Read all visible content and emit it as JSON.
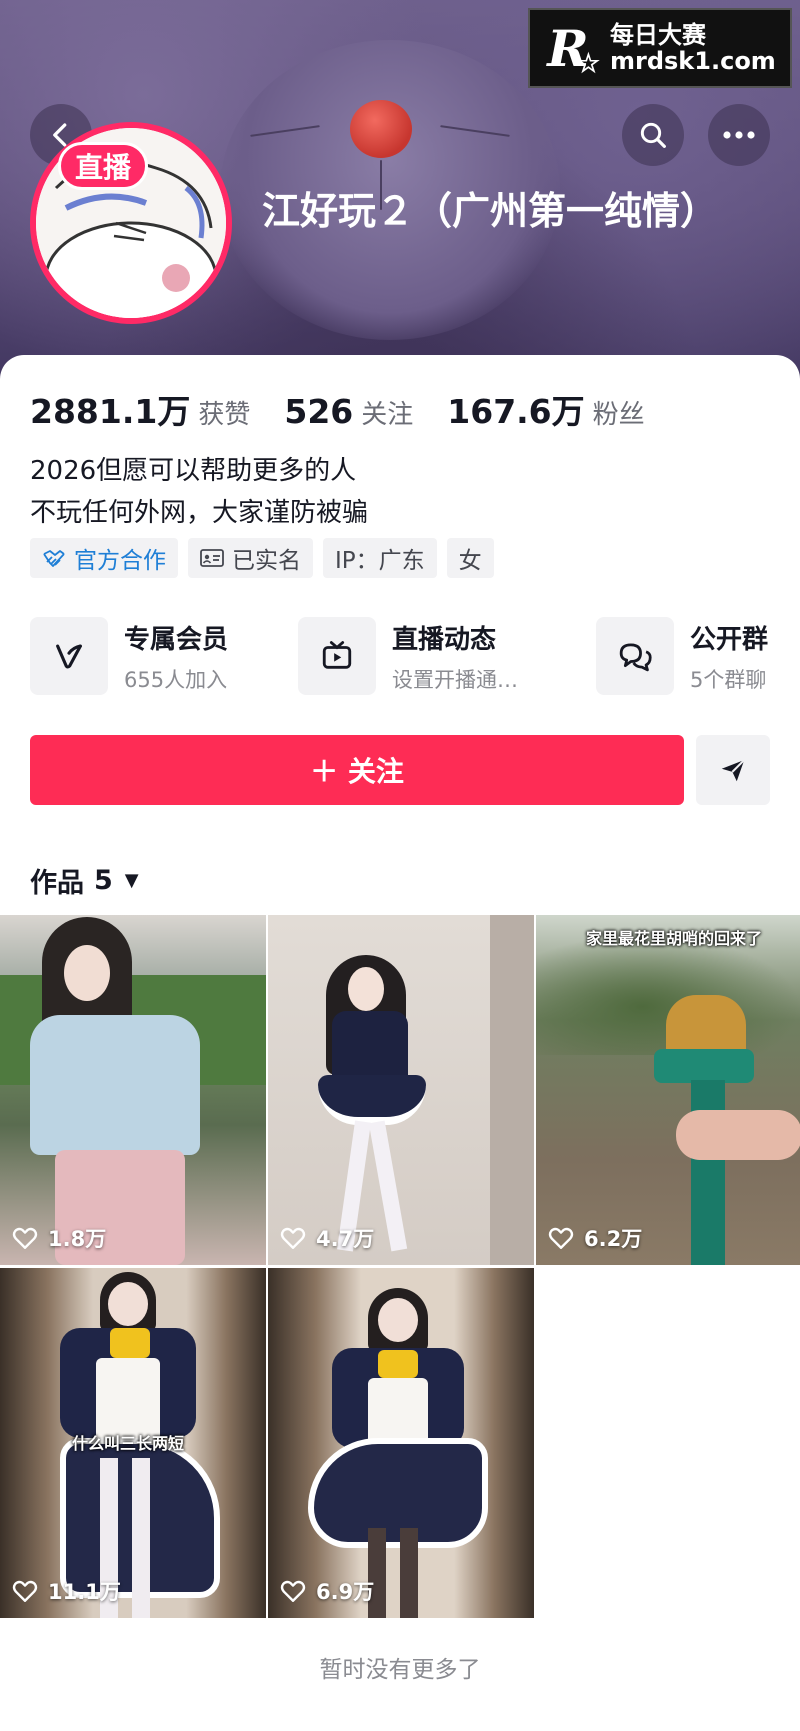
{
  "watermark": {
    "logo": "R",
    "cn": "每日大赛",
    "url": "mrdsk1.com"
  },
  "header": {
    "live_badge": "直播",
    "nickname": "江好玩２（广州第一纯情）"
  },
  "stats": [
    {
      "value": "2881.1万",
      "label": "获赞"
    },
    {
      "value": "526",
      "label": "关注"
    },
    {
      "value": "167.6万",
      "label": "粉丝"
    }
  ],
  "bio": [
    "2026但愿可以帮助更多的人",
    "不玩任何外网，大家谨防被骗"
  ],
  "tags": [
    {
      "label": "官方合作",
      "icon": "handshake-icon"
    },
    {
      "label": "已实名",
      "icon": "id-card-icon"
    },
    {
      "label": "IP：广东",
      "icon": ""
    },
    {
      "label": "女",
      "icon": ""
    }
  ],
  "features": [
    {
      "title": "专属会员",
      "sub": "655人加入",
      "icon": "v-icon"
    },
    {
      "title": "直播动态",
      "sub": "设置开播通…",
      "icon": "tv-icon"
    },
    {
      "title": "公开群",
      "sub": "5个群聊",
      "icon": "chat-bubbles-icon"
    }
  ],
  "follow_label": "＋ 关注",
  "works": {
    "label": "作品",
    "count": "5"
  },
  "videos": [
    {
      "likes": "1.8万",
      "overlay": ""
    },
    {
      "likes": "4.7万",
      "overlay": ""
    },
    {
      "likes": "6.2万",
      "overlay": "家里最花里胡哨的回来了"
    },
    {
      "likes": "11.1万",
      "overlay": "什么叫三长两短"
    },
    {
      "likes": "6.9万",
      "overlay": ""
    }
  ],
  "footer_text": "暂时没有更多了",
  "colors": {
    "accent": "#fe2c55",
    "official_tag": "#1f7fd6",
    "banner": "#5a4c78"
  }
}
